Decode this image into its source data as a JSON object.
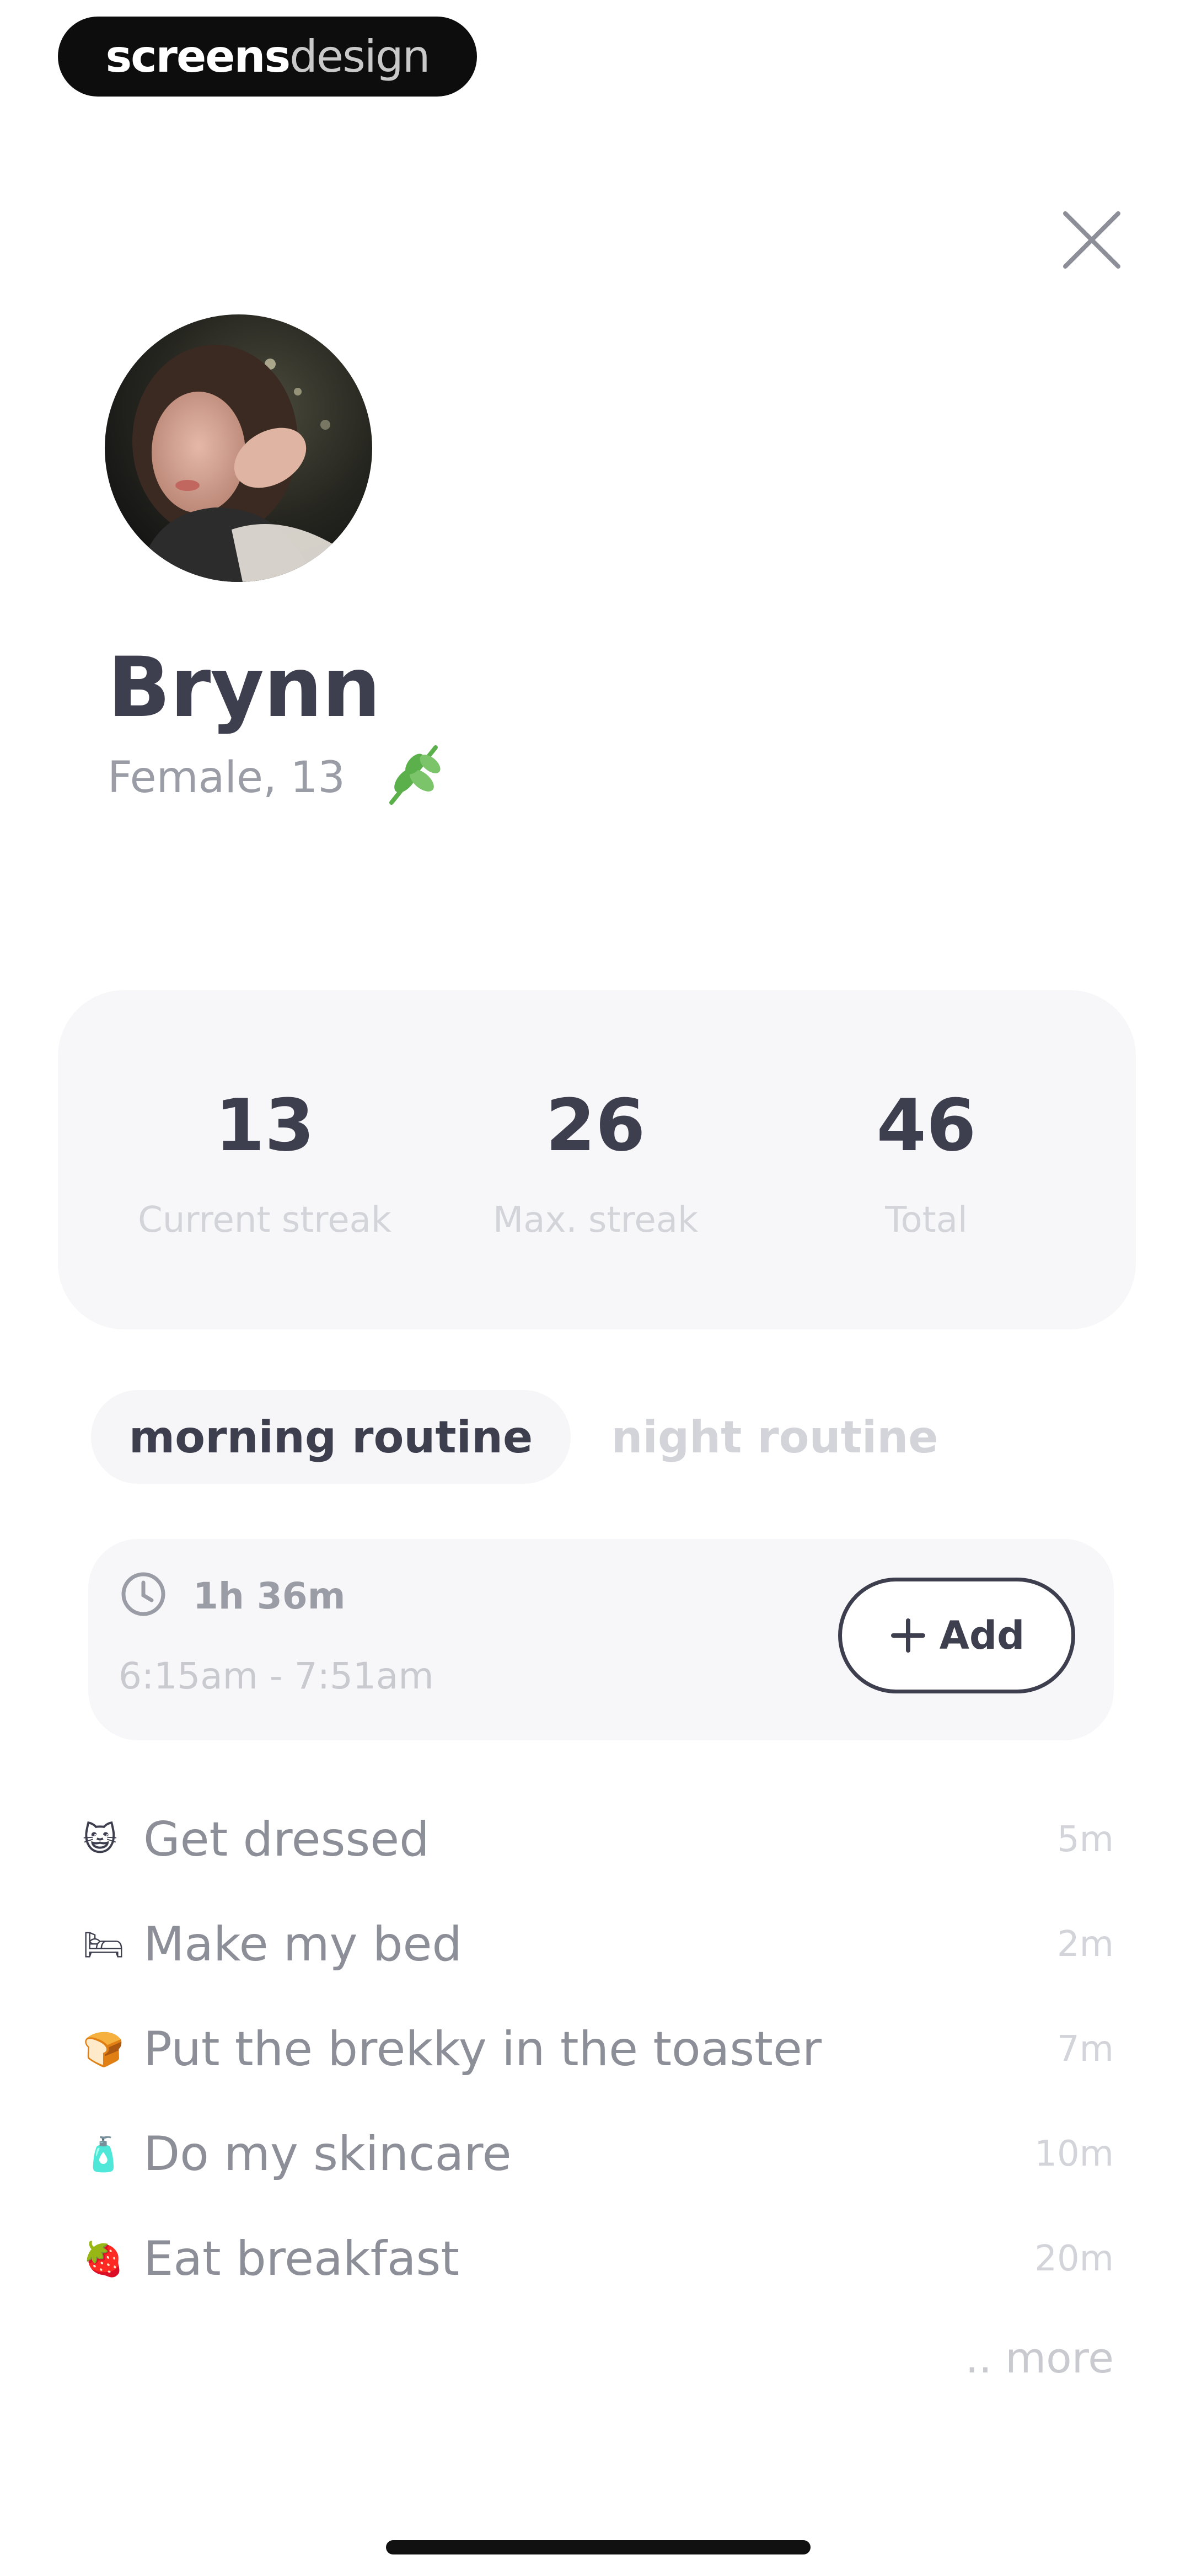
{
  "watermark": {
    "bold": "screens",
    "light": "design"
  },
  "profile": {
    "name": "Brynn",
    "subtitle": "Female, 13"
  },
  "stats": [
    {
      "value": "13",
      "label": "Current streak"
    },
    {
      "value": "26",
      "label": "Max. streak"
    },
    {
      "value": "46",
      "label": "Total"
    }
  ],
  "tabs": {
    "morning": "morning routine",
    "night": "night routine",
    "active": "morning"
  },
  "routine": {
    "duration": "1h 36m",
    "time_range": "6:15am - 7:51am",
    "add_label": "Add"
  },
  "tasks": [
    {
      "emoji": "😺",
      "label": "Get dressed",
      "duration": "5m"
    },
    {
      "emoji": "🛏",
      "label": "Make my bed",
      "duration": "2m"
    },
    {
      "emoji": "🍞",
      "label": "Put the brekky in the toaster",
      "duration": "7m"
    },
    {
      "emoji": "🧴",
      "label": "Do my skincare",
      "duration": "10m"
    },
    {
      "emoji": "🍓",
      "label": "Eat breakfast",
      "duration": "20m"
    }
  ],
  "more_label": ".. more",
  "colors": {
    "text_dark": "#3d3f4e",
    "text_muted": "#9a9ca6",
    "card_bg": "#f7f7f9",
    "leaf_green": "#5bb04b"
  }
}
